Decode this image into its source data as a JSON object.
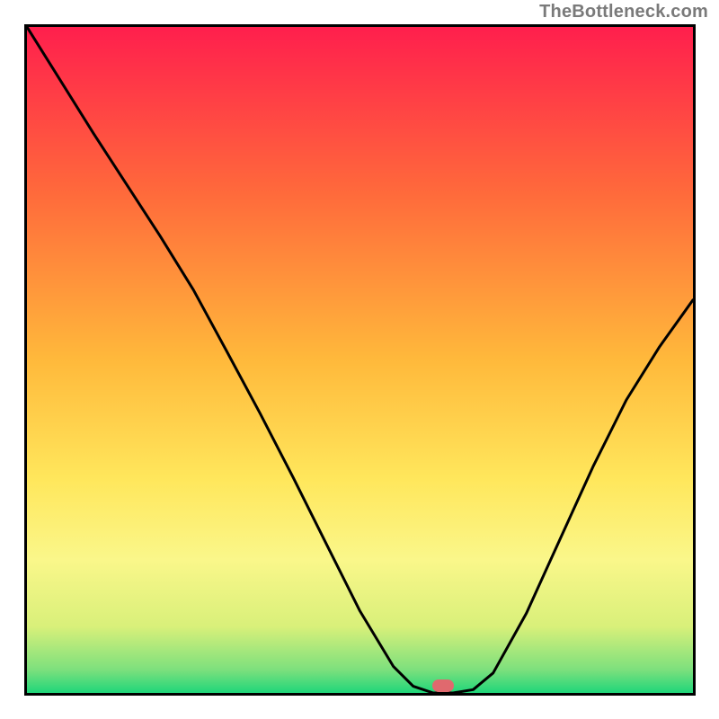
{
  "watermark": "TheBottleneck.com",
  "colors": {
    "border": "#000000",
    "watermark_text": "#7a7a7a",
    "curve_stroke": "#000000",
    "marker": "#e0696e",
    "gradient_stops": [
      {
        "offset": 0.0,
        "color": "#ff1f4d"
      },
      {
        "offset": 0.25,
        "color": "#ff6a3b"
      },
      {
        "offset": 0.5,
        "color": "#ffb93b"
      },
      {
        "offset": 0.68,
        "color": "#ffe75c"
      },
      {
        "offset": 0.8,
        "color": "#faf78a"
      },
      {
        "offset": 0.9,
        "color": "#d9f07a"
      },
      {
        "offset": 0.965,
        "color": "#7de07d"
      },
      {
        "offset": 1.0,
        "color": "#1fd67a"
      }
    ]
  },
  "chart_data": {
    "type": "line",
    "title": "",
    "xlabel": "",
    "ylabel": "",
    "xlim": [
      0,
      1
    ],
    "ylim": [
      0,
      1
    ],
    "series": [
      {
        "name": "curve",
        "x": [
          0.0,
          0.05,
          0.1,
          0.15,
          0.2,
          0.25,
          0.3,
          0.35,
          0.4,
          0.45,
          0.5,
          0.55,
          0.58,
          0.61,
          0.64,
          0.67,
          0.7,
          0.75,
          0.8,
          0.85,
          0.9,
          0.95,
          1.0
        ],
        "y": [
          1.0,
          0.92,
          0.84,
          0.763,
          0.686,
          0.605,
          0.513,
          0.42,
          0.323,
          0.223,
          0.123,
          0.04,
          0.01,
          0.0,
          0.0,
          0.005,
          0.03,
          0.12,
          0.23,
          0.34,
          0.44,
          0.52,
          0.59
        ]
      }
    ],
    "marker": {
      "x": 0.625,
      "y": 0.0
    },
    "notes": "Values are normalized fractions of the plot box (0–1 on each axis). Curve depicts a V-shaped profile with its minimum near x≈0.63; left branch starts at top-left (y=1), right branch rises to y≈0.59 at x=1."
  }
}
